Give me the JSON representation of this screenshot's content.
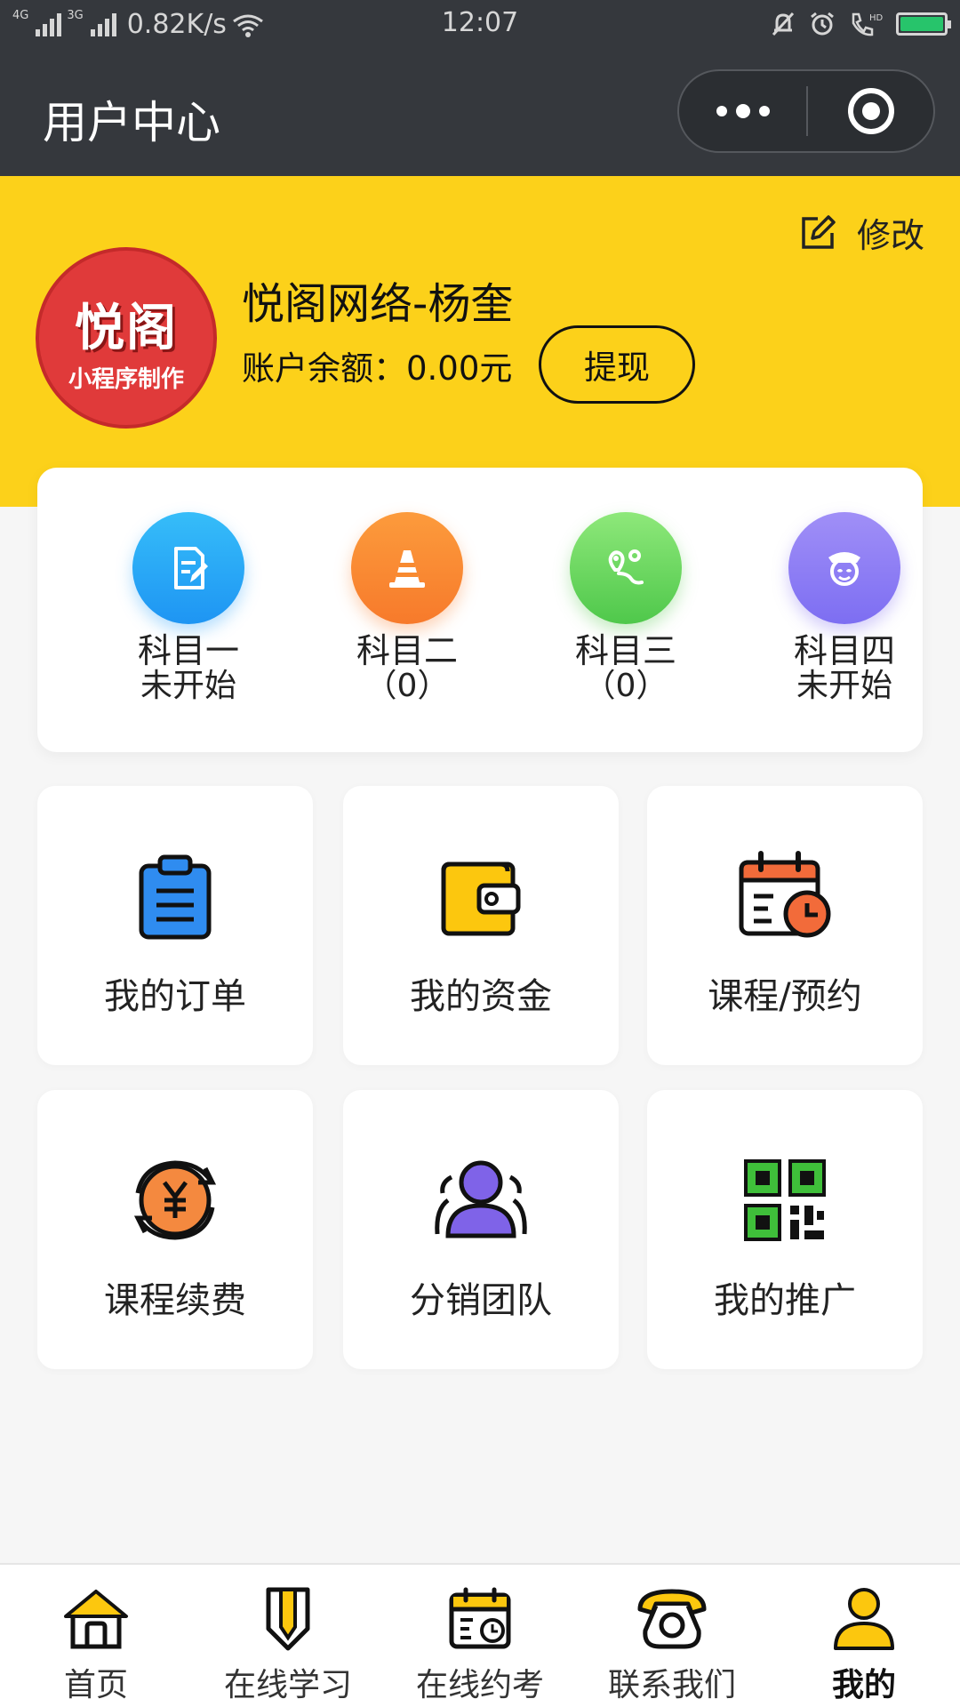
{
  "status_bar": {
    "network_1": "4G",
    "network_2": "3G",
    "speed": "0.82K/s",
    "time": "12:07",
    "icons": [
      "wifi-icon",
      "mute-icon",
      "alarm-icon",
      "hd-call-icon",
      "battery-icon"
    ]
  },
  "nav": {
    "title": "用户中心"
  },
  "profile": {
    "edit_label": "修改",
    "avatar_text_1": "悦阁",
    "avatar_text_2": "小程序制作",
    "user_name": "悦阁网络-杨奎",
    "balance_label": "账户余额：0.00元",
    "withdraw_label": "提现"
  },
  "subjects": [
    {
      "label": "科目一",
      "status": "未开始",
      "icon": "exam-paper-icon",
      "color": "#27a6f7"
    },
    {
      "label": "科目二",
      "status": "（0）",
      "icon": "traffic-cone-icon",
      "color": "#fb8b32"
    },
    {
      "label": "科目三",
      "status": "（0）",
      "icon": "route-map-icon",
      "color": "#5fd45b"
    },
    {
      "label": "科目四",
      "status": "未开始",
      "icon": "officer-icon",
      "color": "#8c7ef5"
    }
  ],
  "menu": [
    {
      "label": "我的订单",
      "icon": "clipboard-icon"
    },
    {
      "label": "我的资金",
      "icon": "wallet-icon"
    },
    {
      "label": "课程/预约",
      "icon": "calendar-clock-icon"
    },
    {
      "label": "课程续费",
      "icon": "yuan-renew-icon"
    },
    {
      "label": "分销团队",
      "icon": "team-icon"
    },
    {
      "label": "我的推广",
      "icon": "qr-code-icon"
    }
  ],
  "tabs": [
    {
      "label": "首页",
      "icon": "home-icon"
    },
    {
      "label": "在线学习",
      "icon": "pencil-icon"
    },
    {
      "label": "在线约考",
      "icon": "calendar-icon"
    },
    {
      "label": "联系我们",
      "icon": "telephone-icon"
    },
    {
      "label": "我的",
      "icon": "user-icon",
      "active": true
    }
  ],
  "colors": {
    "header_dark": "#35383d",
    "brand_yellow": "#fcd11a",
    "background": "#f6f6f6"
  }
}
